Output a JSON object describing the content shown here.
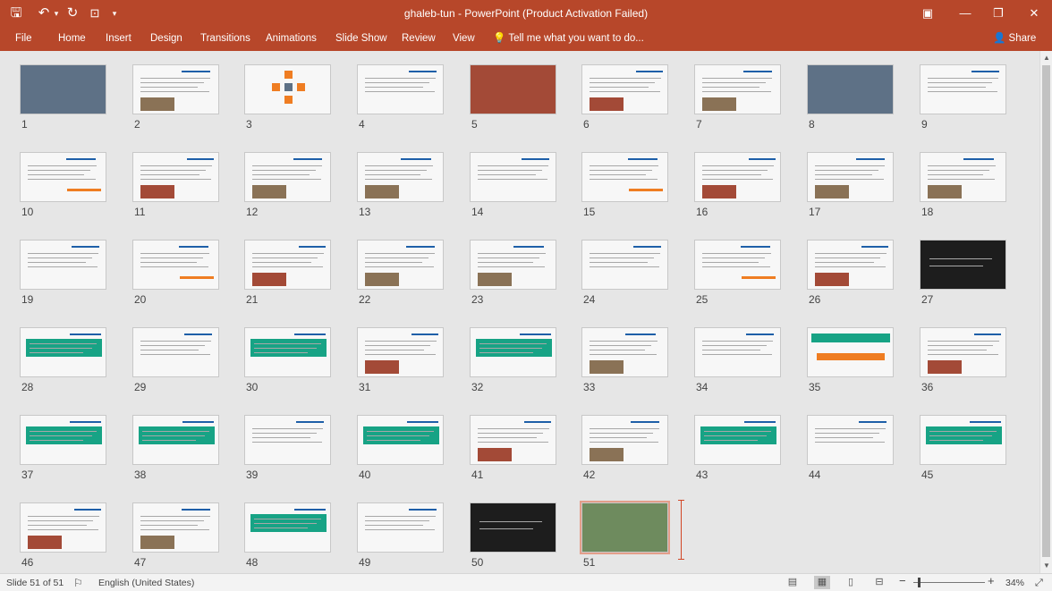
{
  "window": {
    "title": "ghaleb-tun  -  PowerPoint (Product Activation Failed)",
    "controls": {
      "ribbon_display": "▣",
      "minimize": "—",
      "restore": "❐",
      "close": "✕"
    }
  },
  "quick_access": {
    "save": "save-icon",
    "undo": "undo-icon",
    "undo_dropdown": "▾",
    "redo": "redo-icon",
    "present": "start-from-beginning-icon",
    "customize": "▾"
  },
  "ribbon": {
    "tabs": [
      "File",
      "Home",
      "Insert",
      "Design",
      "Transitions",
      "Animations",
      "Slide Show",
      "Review",
      "View"
    ],
    "tell_me": "Tell me what you want to do...",
    "share": "Share"
  },
  "slides": [
    {
      "n": "1"
    },
    {
      "n": "2"
    },
    {
      "n": "3"
    },
    {
      "n": "4"
    },
    {
      "n": "5"
    },
    {
      "n": "6"
    },
    {
      "n": "7"
    },
    {
      "n": "8"
    },
    {
      "n": "9"
    },
    {
      "n": "10"
    },
    {
      "n": "11"
    },
    {
      "n": "12"
    },
    {
      "n": "13"
    },
    {
      "n": "14"
    },
    {
      "n": "15"
    },
    {
      "n": "16"
    },
    {
      "n": "17"
    },
    {
      "n": "18"
    },
    {
      "n": "19"
    },
    {
      "n": "20"
    },
    {
      "n": "21"
    },
    {
      "n": "22"
    },
    {
      "n": "23"
    },
    {
      "n": "24"
    },
    {
      "n": "25"
    },
    {
      "n": "26"
    },
    {
      "n": "27"
    },
    {
      "n": "28"
    },
    {
      "n": "29"
    },
    {
      "n": "30"
    },
    {
      "n": "31"
    },
    {
      "n": "32"
    },
    {
      "n": "33"
    },
    {
      "n": "34"
    },
    {
      "n": "35"
    },
    {
      "n": "36"
    },
    {
      "n": "37"
    },
    {
      "n": "38"
    },
    {
      "n": "39"
    },
    {
      "n": "40"
    },
    {
      "n": "41"
    },
    {
      "n": "42"
    },
    {
      "n": "43"
    },
    {
      "n": "44"
    },
    {
      "n": "45"
    },
    {
      "n": "46"
    },
    {
      "n": "47"
    },
    {
      "n": "48"
    },
    {
      "n": "49"
    },
    {
      "n": "50"
    },
    {
      "n": "51"
    }
  ],
  "selected_slide": "51",
  "status": {
    "slide_indicator": "Slide 51 of 51",
    "language": "English (United States)",
    "zoom": "34%",
    "zoom_minus": "−",
    "zoom_plus": "+"
  },
  "colors": {
    "accent": "#b7472a",
    "status_bg": "#f3f3f3",
    "canvas": "#e6e6e6"
  }
}
